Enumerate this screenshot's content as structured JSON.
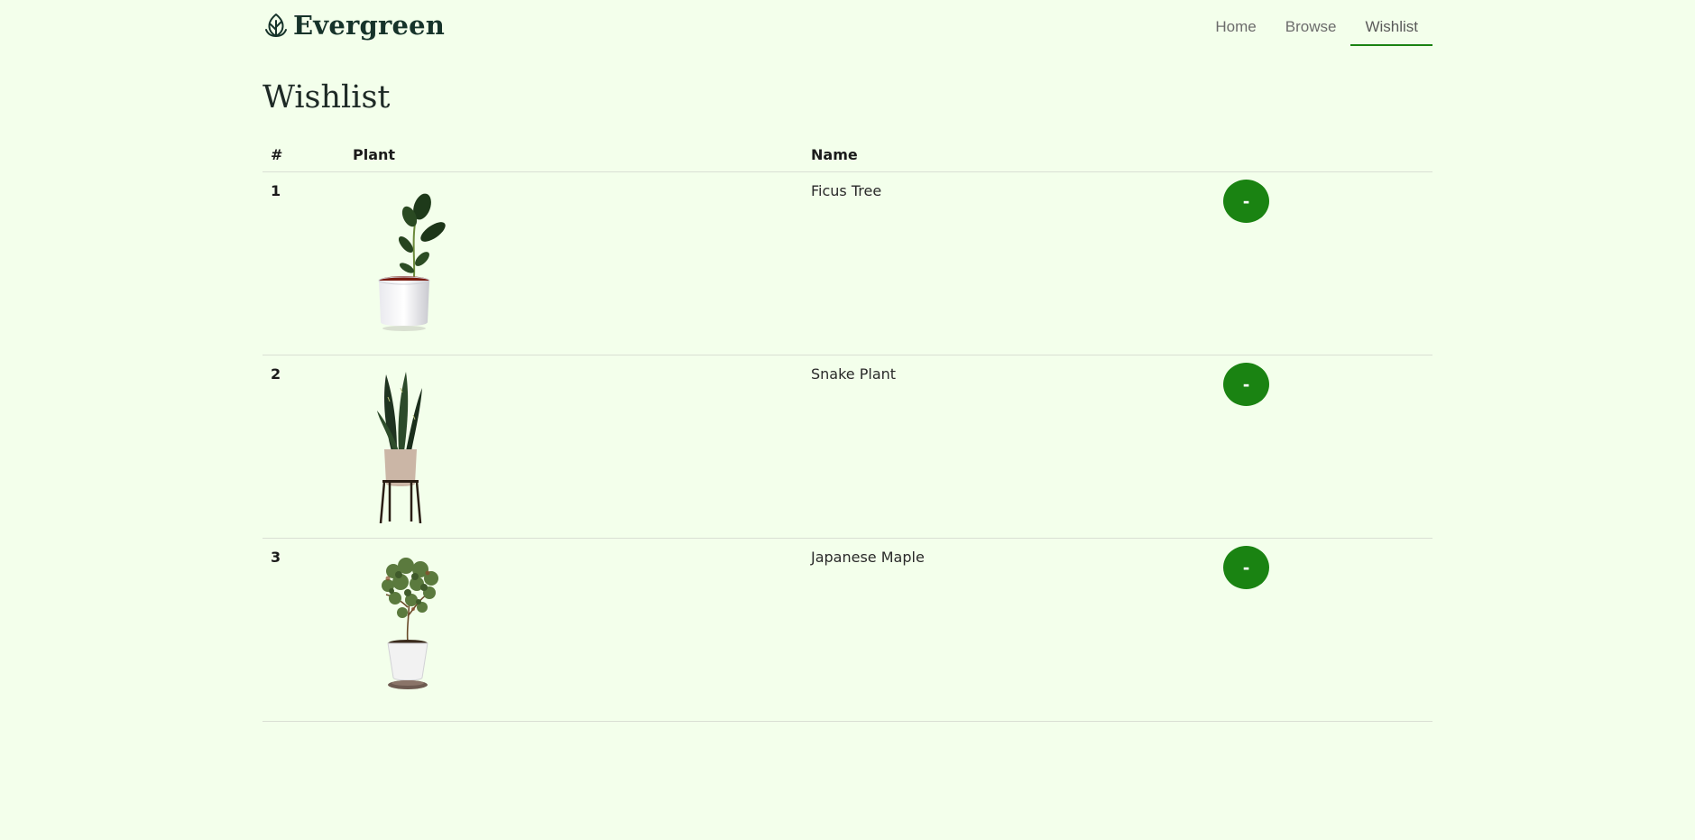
{
  "brand": {
    "name": "Evergreen",
    "icon": "leaf-icon"
  },
  "nav": {
    "items": [
      {
        "label": "Home",
        "active": false
      },
      {
        "label": "Browse",
        "active": false
      },
      {
        "label": "Wishlist",
        "active": true
      }
    ]
  },
  "page": {
    "title": "Wishlist"
  },
  "table": {
    "headers": {
      "num": "#",
      "plant": "Plant",
      "name": "Name"
    },
    "rows": [
      {
        "num": "1",
        "name": "Ficus Tree",
        "image": "ficus-tree-image",
        "action": "-"
      },
      {
        "num": "2",
        "name": "Snake Plant",
        "image": "snake-plant-image",
        "action": "-"
      },
      {
        "num": "3",
        "name": "Japanese Maple",
        "image": "japanese-maple-image",
        "action": "-"
      }
    ]
  },
  "colors": {
    "background": "#f3ffeb",
    "accent": "#1a8312",
    "brand": "#16332a"
  }
}
